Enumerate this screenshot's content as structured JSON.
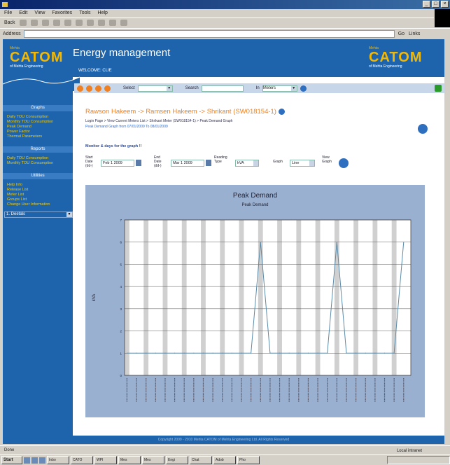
{
  "browser": {
    "title": "",
    "menu": [
      "File",
      "Edit",
      "View",
      "Favorites",
      "Tools",
      "Help"
    ],
    "back_label": "Back",
    "address_label": "Address",
    "address_value": "",
    "go_label": "Go",
    "links_label": "Links",
    "status_text": "Done",
    "status_zone": "Local intranet"
  },
  "header": {
    "brand_small": "Mehta",
    "brand_name": "CATOM",
    "brand_sub": "of Mehta Engineering",
    "app_title": "Energy management",
    "welcome": "WELCOME: CLIE"
  },
  "sidebar": {
    "section1_title": "Graphs",
    "section1_items": [
      "Daily TOU Consumption",
      "Monthly TOU Consumption",
      "Peak Demand",
      "Power Factor",
      "Thermal Parameters"
    ],
    "section2_title": "Reports",
    "section2_items": [
      "Daily TOU Consumption",
      "Monthly TOU Consumption"
    ],
    "section3_title": "Utilities",
    "section3_items": [
      "Help Info",
      "Release List",
      "Meter List",
      "Groups List",
      "Change User Information"
    ],
    "select_value": "1. Deetals"
  },
  "topstrip": {
    "select_label": "Select",
    "select_value": "",
    "search_label": "Search",
    "search_value": "",
    "in_label": "In",
    "in_value": "Meters"
  },
  "page": {
    "crumb": "Rawson Hakeem -> Ramsen Hakeem -> Shrikant (SW018154-1)",
    "breadline": "Login Page > View Current Meters List > Shrikant Meter (SW018154-1) > Peak Demand Graph",
    "period_desc": "Peak Demand Graph from 07/01/2009 To 08/01/2009",
    "section_title": "Monitor & days for the graph !!",
    "start_label": "Start Date (dd-)",
    "start_value": "Feb 1 2009",
    "end_label": "End Date (dd-)",
    "end_value": "Mar 1 2009",
    "reading_label": "Reading Type",
    "reading_value": "kVA",
    "graph_label": "Graph",
    "graph_value": "Line",
    "view_label": "View Graph",
    "footer": "Copyright 2009 - 2010 Mehta CATOM of Mehta Engineering Ltd. All Rights Reserved"
  },
  "chart_data": {
    "type": "line",
    "title": "Peak Demand",
    "subtitle": "Peak Demand",
    "xlabel": "",
    "ylabel": "kVA",
    "grid": true,
    "ylim": [
      0,
      7
    ],
    "y_ticks": [
      0,
      1,
      2,
      3,
      4,
      5,
      6,
      7
    ],
    "x_count": 30,
    "series": [
      {
        "name": "",
        "color": "#5a8aa8",
        "values": [
          1,
          1,
          1,
          1,
          1,
          1,
          1,
          1,
          1,
          1,
          1,
          1,
          1,
          1,
          6,
          1,
          1,
          1,
          1,
          1,
          1,
          1,
          6,
          1,
          1,
          1,
          1,
          1,
          1,
          6
        ]
      }
    ]
  },
  "colors": {
    "brand_blue": "#1e64ac",
    "brand_orange": "#f08020",
    "brand_gold": "#f5b800",
    "taskbar_gray": "#d4d0c8"
  },
  "taskbar": {
    "start_label": "Start",
    "tasks": [
      "Inbo",
      "CATO",
      "WPI",
      "Mes",
      "Mes",
      "Engi",
      "Chat",
      "Adob",
      "Pho"
    ],
    "clock": ""
  }
}
